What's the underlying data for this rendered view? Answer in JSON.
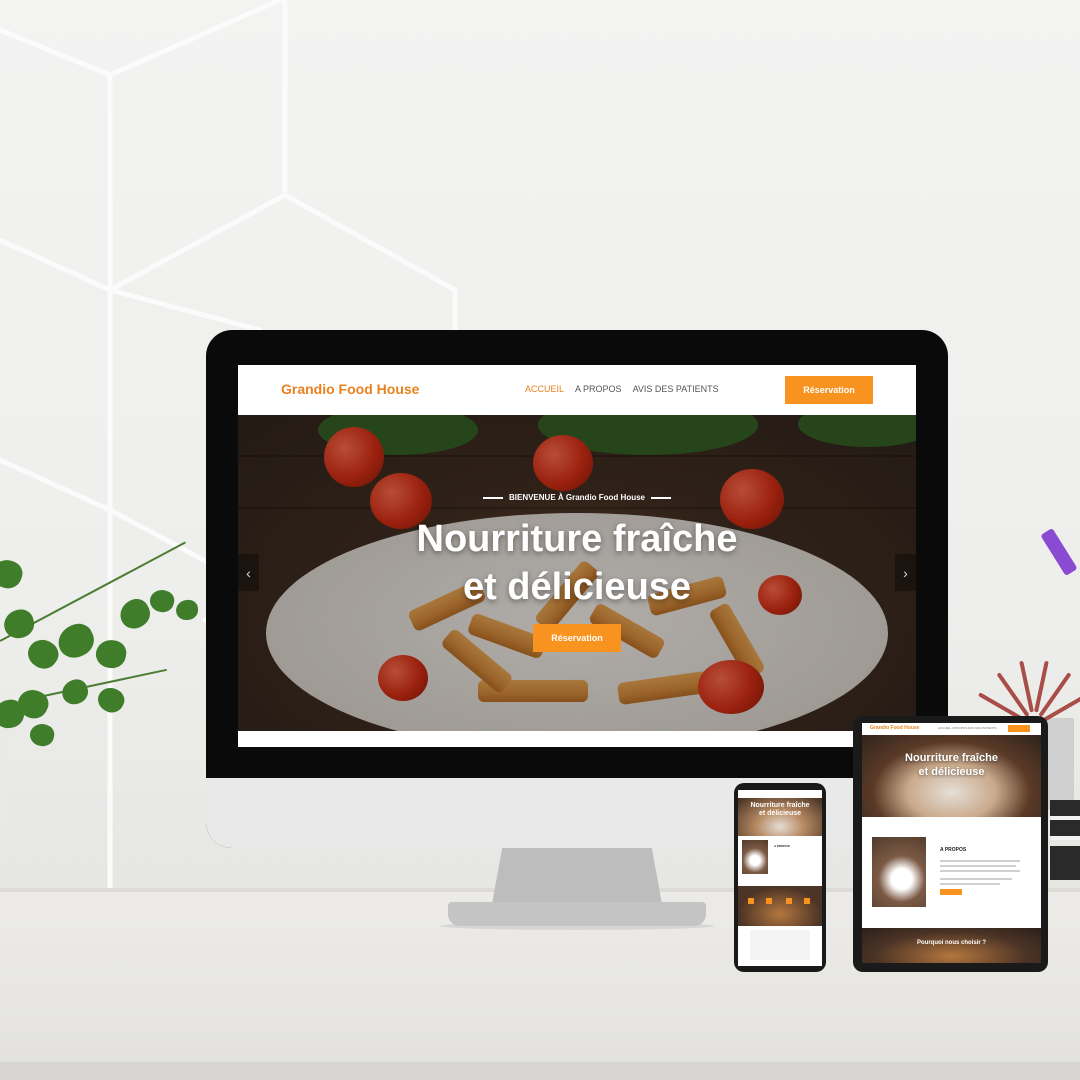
{
  "site": {
    "brand": "Grandio Food House",
    "nav": [
      {
        "label": "ACCUEIL",
        "active": true
      },
      {
        "label": "A PROPOS",
        "active": false
      },
      {
        "label": "AVIS DES PATIENTS",
        "active": false
      }
    ],
    "cta_label": "Réservation",
    "hero": {
      "kicker": "BIENVENUE À Grandio Food House",
      "title_line1": "Nourriture fraîche",
      "title_line2": "et délicieuse",
      "button_label": "Réservation",
      "prev_icon": "chevron-left-icon",
      "next_icon": "chevron-right-icon"
    }
  },
  "tablet": {
    "brand": "Grandio Food House",
    "title_line1": "Nourriture fraîche",
    "title_line2": "et délicieuse",
    "about_title": "A PROPOS",
    "why_title": "Pourquoi nous choisir ?"
  },
  "phone": {
    "title_line1": "Nourriture fraîche",
    "title_line2": "et délicieuse",
    "about_title": "A PROPOS"
  },
  "colors": {
    "accent": "#f7931e",
    "brand_text": "#e8821e"
  }
}
